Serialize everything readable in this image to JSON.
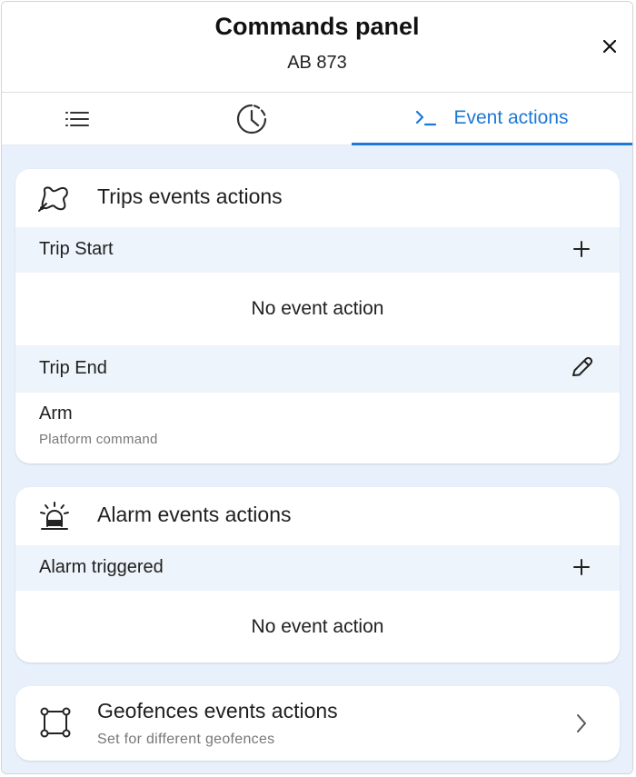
{
  "header": {
    "title": "Commands panel",
    "subtitle": "AB 873",
    "close_icon": "close-icon"
  },
  "tabs": [
    {
      "icon": "list-icon",
      "label": ""
    },
    {
      "icon": "history-clock-icon",
      "label": ""
    },
    {
      "icon": "terminal-prompt-icon",
      "label": "Event actions",
      "active": true
    }
  ],
  "sections": {
    "trips": {
      "icon": "route-icon",
      "title": "Trips events actions",
      "trip_start": {
        "label": "Trip Start",
        "action_icon": "plus-icon",
        "empty_text": "No event action"
      },
      "trip_end": {
        "label": "Trip End",
        "action_icon": "pencil-icon",
        "item": {
          "name": "Arm",
          "type": "Platform command"
        }
      }
    },
    "alarm": {
      "icon": "siren-icon",
      "title": "Alarm events actions",
      "alarm_triggered": {
        "label": "Alarm triggered",
        "action_icon": "plus-icon",
        "empty_text": "No event action"
      }
    },
    "geofences": {
      "icon": "polygon-icon",
      "title": "Geofences events actions",
      "subtitle": "Set for different geofences",
      "chevron_icon": "chevron-right-icon"
    }
  },
  "colors": {
    "accent": "#1e78d6",
    "content_bg": "#e8f1fb",
    "row_bg": "#eef4fb",
    "muted_text": "#777777"
  }
}
